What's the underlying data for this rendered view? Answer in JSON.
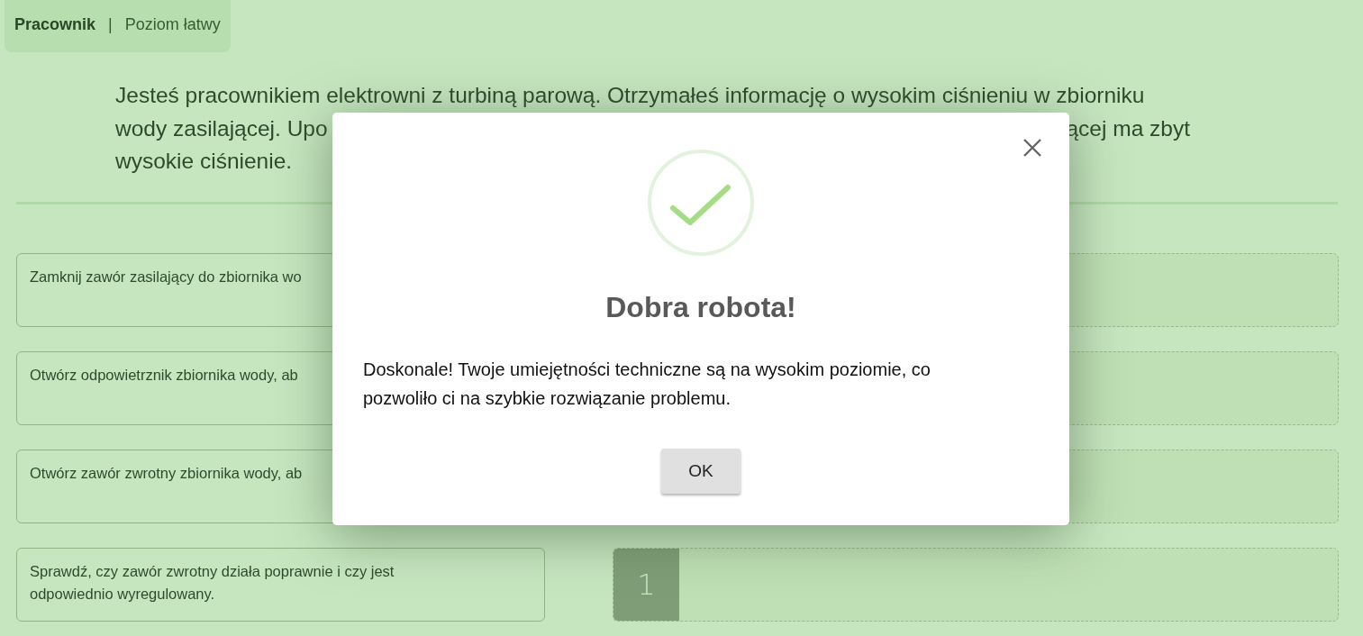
{
  "header": {
    "role": "Pracownik",
    "separator": "|",
    "level": "Poziom łatwy"
  },
  "intro_lines": [
    [
      "Jesteś pracownikiem elektrowni z turbiną parową. Otrzymałeś informację o wysokim ciśnieniu w zbiorniku"
    ],
    [
      "wody zasilającej. Upo",
      "ącej ma zbyt"
    ],
    [
      "wysokie ciśnienie."
    ]
  ],
  "steps": [
    {
      "text": "Zamknij zawór zasilający do zbiornika wo"
    },
    {
      "text": "Otwórz odpowietrznik zbiornika wody, ab"
    },
    {
      "text": "Otwórz zawór zwrotny zbiornika wody, ab"
    },
    {
      "text": "Sprawdź, czy zawór zwrotny działa poprawnie i czy jest odpowiednio wyregulowany."
    }
  ],
  "answer_slots": [
    {
      "kind": "empty"
    },
    {
      "kind": "empty"
    },
    {
      "kind": "empty"
    },
    {
      "kind": "numbered",
      "number": "1"
    }
  ],
  "dialog": {
    "title": "Dobra robota!",
    "message": "Doskonale! Twoje umiejętności techniczne są na wysokim poziomie, co pozwoliło ci na szybkie rozwiązanie problemu.",
    "button": "OK"
  }
}
